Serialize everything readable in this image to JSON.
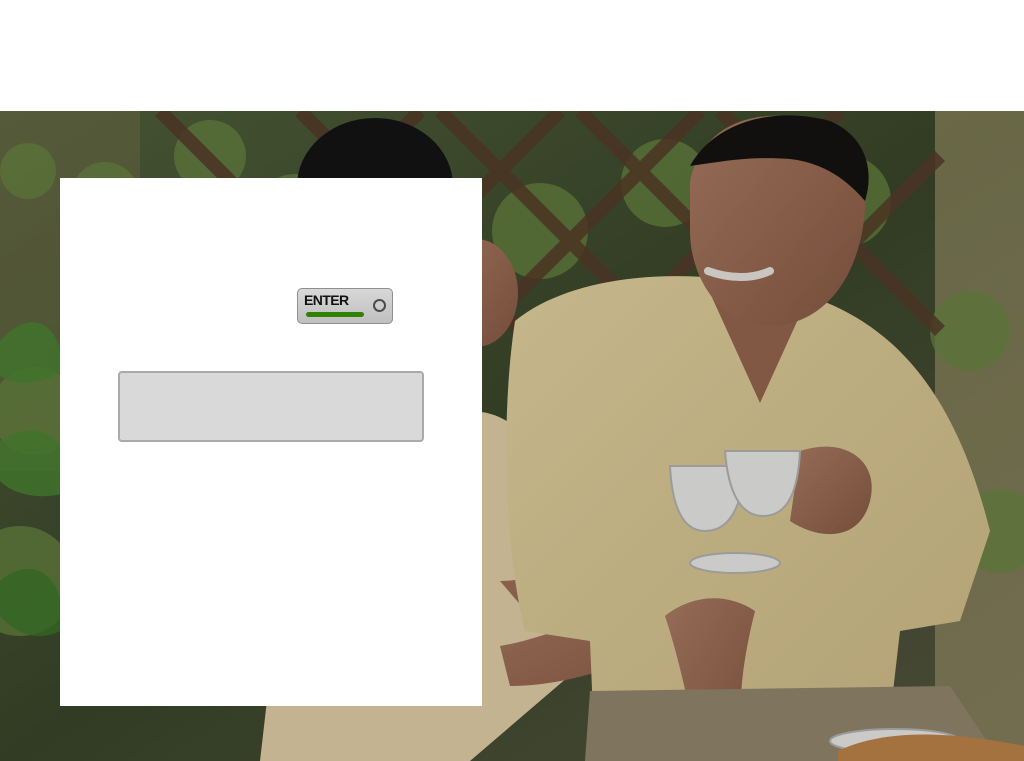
{
  "login_panel": {
    "enter_button": {
      "label": "ENTER"
    },
    "input": {
      "value": "",
      "placeholder": ""
    }
  },
  "colors": {
    "enter_bar_green": "#338100",
    "field_fill": "#d9d9d9",
    "panel_background": "#ffffff"
  }
}
